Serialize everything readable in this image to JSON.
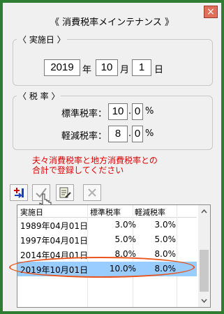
{
  "window": {
    "title": "《 消費税率メインテナンス 》",
    "close_label": "×"
  },
  "date_group": {
    "label": "〈 実施日 〉",
    "year": "2019",
    "year_unit": "年",
    "month": "10",
    "month_unit": "月",
    "day": "1",
    "day_unit": "日"
  },
  "rate_group": {
    "label": "〈 税 率 〉",
    "standard_label": "標準税率：",
    "standard_int": "10",
    "standard_dec": "0",
    "standard_unit": "%",
    "reduced_label": "軽減税率：",
    "reduced_int": "8",
    "reduced_dec": "0",
    "reduced_unit": "%",
    "dot": "."
  },
  "note": {
    "line1": "夫々消費税率と地方消費税率との",
    "line2": "合計で登録してください"
  },
  "toolbar": {
    "icons": [
      "add-row-icon",
      "check-icon",
      "edit-icon",
      "delete-icon"
    ]
  },
  "table": {
    "columns": [
      "実施日",
      "標準税率",
      "軽減税率"
    ],
    "rows": [
      {
        "date": "1989年04月01日",
        "standard": "3.0%",
        "reduced": "3.0%"
      },
      {
        "date": "1997年04月01日",
        "standard": "5.0%",
        "reduced": "5.0%"
      },
      {
        "date": "2014年04月01日",
        "standard": "8.0%",
        "reduced": "8.0%"
      },
      {
        "date": "2019年10月01日",
        "standard": "10.0%",
        "reduced": "8.0%"
      }
    ],
    "selected_index": 3,
    "highlight_color": "#e8541c"
  }
}
